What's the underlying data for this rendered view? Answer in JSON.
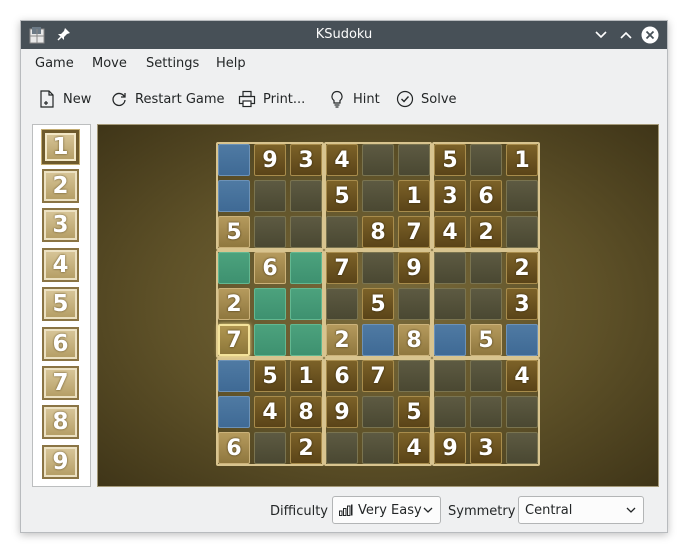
{
  "window": {
    "title": "KSudoku"
  },
  "menu": [
    "Game",
    "Move",
    "Settings",
    "Help"
  ],
  "toolbar": {
    "new": "New",
    "restart": "Restart Game",
    "print": "Print...",
    "hint": "Hint",
    "solve": "Solve"
  },
  "numbers": [
    "1",
    "2",
    "3",
    "4",
    "5",
    "6",
    "7",
    "8",
    "9"
  ],
  "selected_number": "1",
  "board": [
    [
      "",
      "9",
      "3",
      "4",
      "",
      "",
      "5",
      "",
      "1"
    ],
    [
      "",
      "",
      "",
      "5",
      "",
      "1",
      "3",
      "6",
      ""
    ],
    [
      "5",
      "",
      "",
      "",
      "8",
      "7",
      "4",
      "2",
      ""
    ],
    [
      "",
      "6",
      "",
      "7",
      "",
      "9",
      "",
      "",
      "2"
    ],
    [
      "2",
      "",
      "",
      "",
      "5",
      "",
      "",
      "",
      "3"
    ],
    [
      "7",
      "",
      "",
      "2",
      "",
      "8",
      "",
      "5",
      ""
    ],
    [
      "",
      "5",
      "1",
      "6",
      "7",
      "",
      "",
      "",
      "4"
    ],
    [
      "",
      "4",
      "8",
      "9",
      "",
      "5",
      "",
      "",
      ""
    ],
    [
      "6",
      "",
      "2",
      "",
      "",
      "4",
      "9",
      "3",
      ""
    ]
  ],
  "status": {
    "difficulty_label": "Difficulty",
    "difficulty_value": "Very Easy",
    "symmetry_label": "Symmetry",
    "symmetry_value": "Central"
  },
  "colors": {
    "highlight_blue": "#4f7aa3",
    "highlight_green": "#4ca27d",
    "given_brown": "#6b5220",
    "block_border": "#d8c48f"
  }
}
